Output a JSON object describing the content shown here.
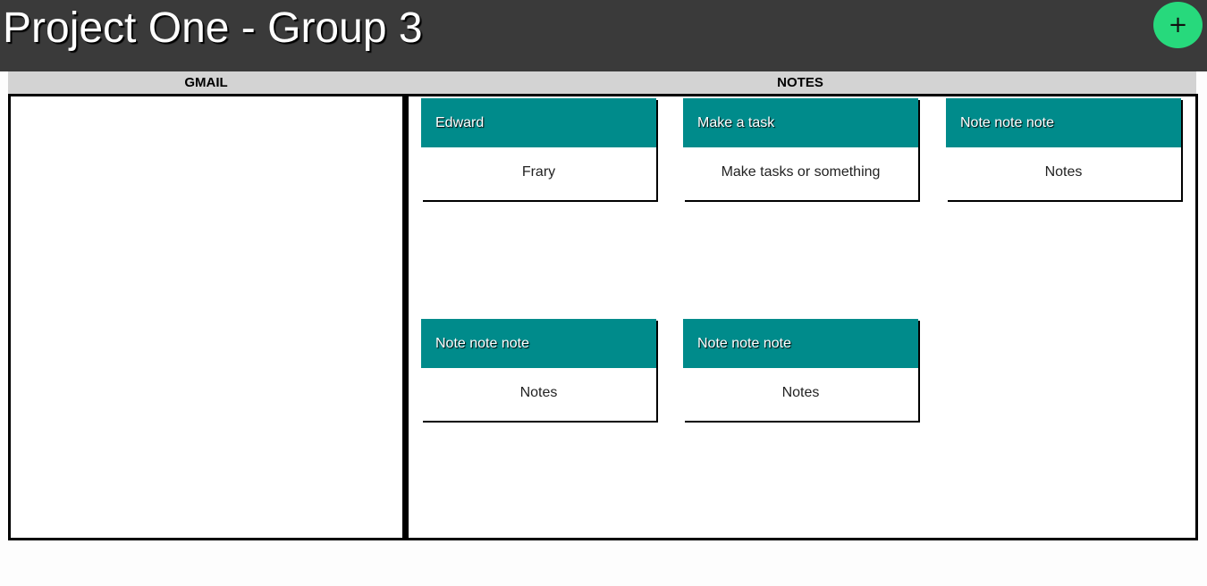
{
  "header": {
    "title": "Project One - Group 3",
    "add_label": "+",
    "add_icon": "plus-icon",
    "accent_color": "#27d97c"
  },
  "columns": {
    "gmail_label": "GMAIL",
    "notes_label": "NOTES"
  },
  "notes": [
    {
      "title": "Edward",
      "body": "Frary"
    },
    {
      "title": "Make a task",
      "body": "Make tasks or something"
    },
    {
      "title": "Note note note",
      "body": "Notes"
    },
    {
      "title": "Note note note",
      "body": "Notes"
    },
    {
      "title": "Note note note",
      "body": "Notes"
    }
  ],
  "colors": {
    "header_bg": "#3a3a3a",
    "note_header_bg": "#008b8b",
    "label_bar_bg": "#d3d3d3"
  }
}
